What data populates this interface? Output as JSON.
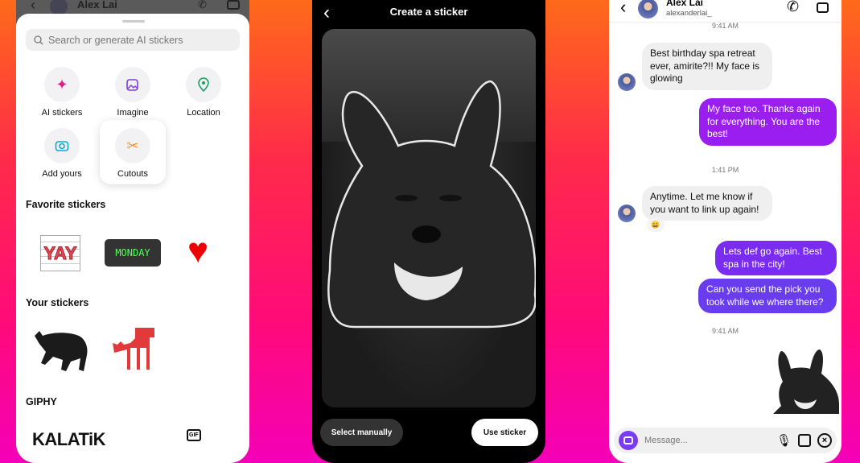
{
  "left": {
    "header_name": "Alex Lai",
    "header_username": "alexanderlai_",
    "search_placeholder": "Search or generate AI stickers",
    "tiles": [
      {
        "label": "AI stickers",
        "icon": "sparkles-icon",
        "color": "#d6248e"
      },
      {
        "label": "Imagine",
        "icon": "image-sparkle-icon",
        "color": "#7b3fe0"
      },
      {
        "label": "Location",
        "icon": "location-pin-icon",
        "color": "#1aa260"
      },
      {
        "label": "Add yours",
        "icon": "camera-icon",
        "color": "#12a5d8"
      },
      {
        "label": "Cutouts",
        "icon": "scissors-icon",
        "color": "#f0922a"
      }
    ],
    "sections": {
      "favorite": "Favorite stickers",
      "yours": "Your stickers",
      "giphy": "GIPHY"
    },
    "favorite_stickers": [
      "YAY",
      "MONDAY",
      "heart"
    ],
    "giphy_items": [
      "KALATiK",
      "GIF"
    ]
  },
  "middle": {
    "title": "Create a sticker",
    "select_manually": "Select manually",
    "use_sticker": "Use sticker"
  },
  "right": {
    "name": "Alex Lai",
    "username": "alexanderlai_",
    "messages": [
      {
        "type": "time",
        "text": "9:41 AM"
      },
      {
        "type": "in",
        "text": "Best birthday spa retreat ever, amirite?!! My face is glowing"
      },
      {
        "type": "out",
        "text": "My face too. Thanks again for everything. You are the best!"
      },
      {
        "type": "time",
        "text": "1:41 PM"
      },
      {
        "type": "in",
        "text": "Anytime. Let me know if you want to link up again!",
        "reaction": "😀"
      },
      {
        "type": "out",
        "text": "Lets def go again. Best spa in the city!"
      },
      {
        "type": "out",
        "text": "Can you send the pick you took while we where there?"
      },
      {
        "type": "time",
        "text": "9:41 AM"
      }
    ],
    "composer_placeholder": "Message...",
    "colors": {
      "out_purple": "#9b1ef0",
      "out_violet": "#7a2cf0",
      "out_indigo": "#6a3cf0"
    }
  }
}
